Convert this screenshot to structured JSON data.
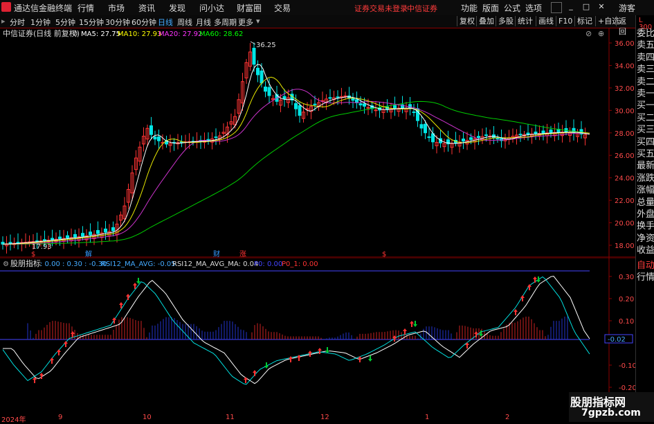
{
  "app": {
    "name": "通达信金融终端",
    "menus": [
      "行情",
      "市场",
      "资讯",
      "发现",
      "问小达",
      "财富圈",
      "交易"
    ],
    "warning": "证券交易未登录",
    "broker": "中信证券",
    "right_menus": [
      "功能",
      "版面",
      "公式",
      "选项"
    ],
    "guest": "游客"
  },
  "period_tabs": [
    "分时",
    "1分钟",
    "5分钟",
    "15分钟",
    "30分钟",
    "60分钟",
    "日线",
    "周线",
    "月线",
    "多周期",
    "更多"
  ],
  "active_period": "日线",
  "toolbar": [
    "复权",
    "叠加",
    "多股",
    "统计",
    "画线",
    "F10",
    "标记",
    "+自选",
    "返回"
  ],
  "main_chart": {
    "title": "中信证券(日线 前复权)",
    "ma_labels": [
      {
        "text": "MA5: 27.75",
        "color": "#ffffff"
      },
      {
        "text": "MA10: 27.93",
        "color": "#ffff00"
      },
      {
        "text": "MA20: 27.92",
        "color": "#ff33ff"
      },
      {
        "text": "MA60: 28.62",
        "color": "#00ff00"
      }
    ],
    "y_ticks": [
      "36.00",
      "34.00",
      "32.00",
      "30.00",
      "28.00",
      "26.00",
      "24.00",
      "22.00",
      "20.00",
      "18.00"
    ],
    "high_label": "36.25",
    "low_label": "17.93",
    "event_markers": [
      {
        "text": "$",
        "color": "#ff3333"
      },
      {
        "text": "解",
        "color": "#3399ff"
      },
      {
        "text": "财",
        "color": "#3399ff"
      },
      {
        "text": "涨",
        "color": "#ff3333"
      },
      {
        "text": "$",
        "color": "#ff3333"
      }
    ]
  },
  "indicator": {
    "title": "股朋指标",
    "params": ": 0.00 : 0.30 : -0.30",
    "rsi_label": "RSI12_MA_AVG: -0.05",
    "rsi_ma_label": "RSI12_MA_AVG_MA: 0.04",
    "p0_label": "P0: 0.00",
    "p0_1_label": "P0_1: 0.00",
    "y_ticks": [
      "0.30",
      "0.20",
      "0.10",
      "-0.02",
      "-0.10",
      "-0.20"
    ]
  },
  "x_axis": [
    "2024年",
    "9",
    "10",
    "11",
    "12",
    "1",
    "2"
  ],
  "right_panel": [
    "委比",
    "卖五",
    "卖四",
    "卖三",
    "卖二",
    "卖一",
    "买一",
    "买二",
    "买三",
    "买四",
    "买五",
    "最新",
    "涨跌",
    "涨幅",
    "总量",
    "外盘",
    "换手",
    "净资",
    "收益",
    "自动",
    "行情"
  ],
  "right_panel_top": "L 300",
  "watermark": {
    "line1": "股朋指标网",
    "line2": "7gpzb.com"
  },
  "colors": {
    "up": "#ff3333",
    "down": "#00ffff",
    "accent": "#a00000",
    "ma5": "#ffffff",
    "ma10": "#ffff00",
    "ma20": "#ff33ff",
    "ma60": "#00ff00"
  }
}
